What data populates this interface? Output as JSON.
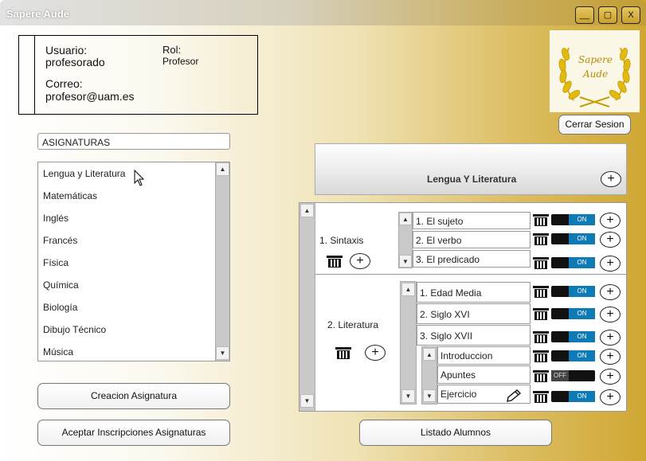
{
  "window": {
    "title": "Sapere Aude",
    "minimize": "__",
    "maximize": "▢",
    "close": "X"
  },
  "user": {
    "user_label": "Usuario:",
    "user_value": "profesorado",
    "role_label": "Rol:",
    "role_value": "Profesor",
    "email_label": "Correo:",
    "email_value": "profesor@uam.es"
  },
  "logo": {
    "line1": "Sapere",
    "line2": "Aude"
  },
  "logout_label": "Cerrar Sesion",
  "subjects": {
    "header": "ASIGNATURAS",
    "items": [
      "Lengua y Literatura",
      "Matemáticas",
      "Inglés",
      "Francés",
      "Física",
      "Química",
      "Biología",
      "Dibujo Técnico",
      "Música"
    ]
  },
  "buttons": {
    "create": "Creacion Asignatura",
    "accept": "Aceptar Inscripciones Asignaturas",
    "students": "Listado Alumnos"
  },
  "course": {
    "title": "Lengua Y Literatura",
    "sections": [
      {
        "name": "1. Sintaxis",
        "topics": [
          "1. El sujeto",
          "2. El verbo",
          "3. El predicado"
        ],
        "visible": [
          "ON",
          "ON",
          "ON"
        ]
      },
      {
        "name": "2. Literatura",
        "topics": [
          "1. Edad Media",
          "2. Siglo XVI",
          "3. Siglo XVII"
        ],
        "visible": [
          "ON",
          "ON",
          "ON"
        ],
        "subtopics": [
          "Introduccion",
          "Apuntes",
          "Ejercicio"
        ],
        "sub_visible": [
          "ON",
          "OFF",
          "ON"
        ]
      }
    ]
  }
}
